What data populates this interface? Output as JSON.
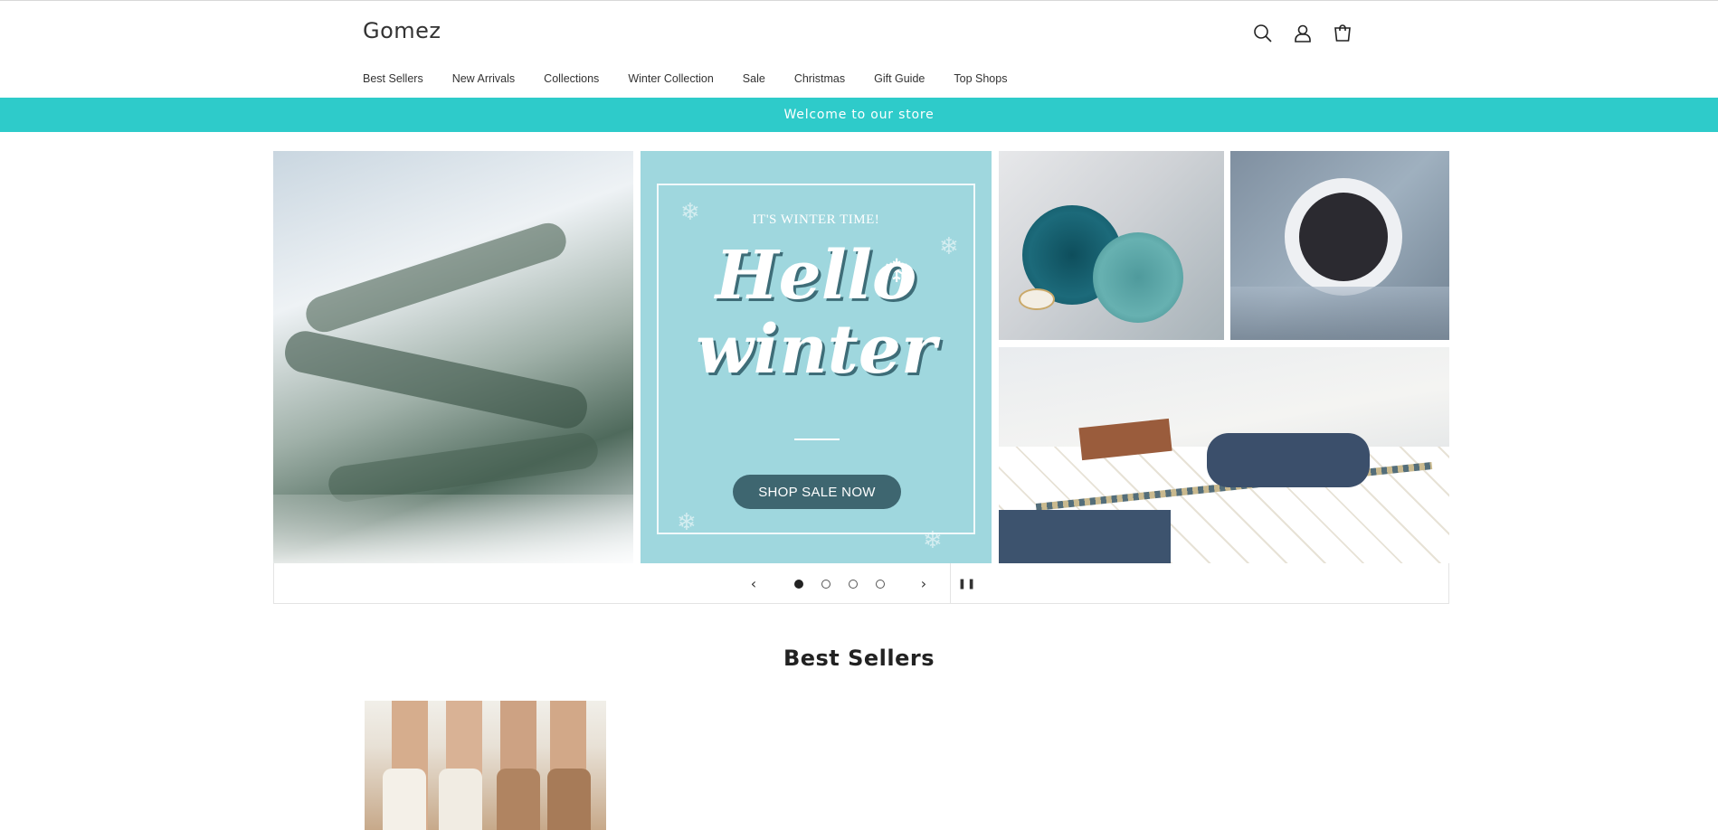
{
  "store": {
    "name": "Gomez"
  },
  "header": {
    "icons": [
      "search-icon",
      "account-icon",
      "cart-icon"
    ]
  },
  "nav": {
    "items": [
      "Best Sellers",
      "New Arrivals",
      "Collections",
      "Winter Collection",
      "Sale",
      "Christmas",
      "Gift Guide",
      "Top Shops"
    ]
  },
  "announcement": {
    "text": "Welcome to our store",
    "color": "#2ecbca"
  },
  "slideshow": {
    "poster": {
      "kicker": "IT'S WINTER TIME!",
      "line1": "Hello",
      "line2": "winter",
      "button": "SHOP SALE NOW"
    },
    "slide_count": 4,
    "active_slide": 1,
    "prev_icon": "chevron-left-icon",
    "next_icon": "chevron-right-icon",
    "pause_icon": "pause-icon"
  },
  "best_sellers": {
    "title": "Best Sellers"
  }
}
